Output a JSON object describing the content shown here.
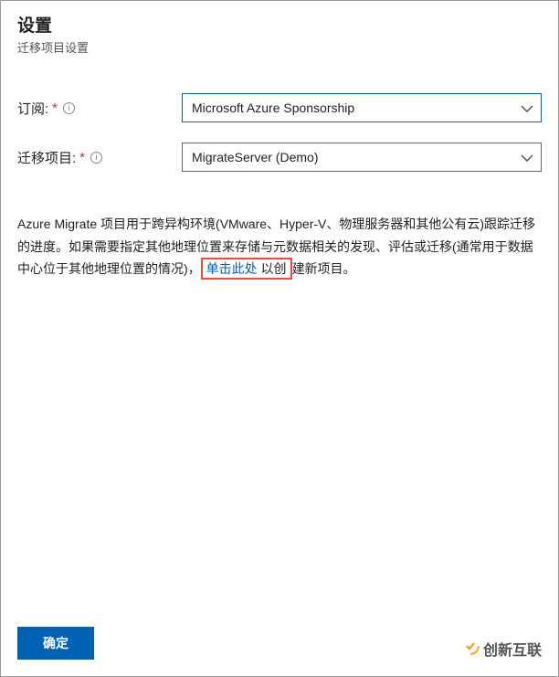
{
  "header": {
    "title": "设置",
    "subtitle": "迁移项目设置"
  },
  "form": {
    "subscription": {
      "label": "订阅:",
      "required": "*",
      "value": "Microsoft Azure Sponsorship"
    },
    "project": {
      "label": "迁移项目:",
      "required": "*",
      "value": "MigrateServer (Demo)"
    }
  },
  "description": {
    "part1": "Azure Migrate 项目用于跨异构环境(VMware、Hyper-V、物理服务器和其他公有云)跟踪迁移的进度。如果需要指定其他地理位置来存储与元数据相关的发现、评估或迁移(通常用于数据中心位于其他地理位置的情况)，",
    "link": "单击此处",
    "part2": " 以创建新项目。"
  },
  "footer": {
    "ok": "确定"
  },
  "watermark": {
    "text": "创新互联"
  }
}
